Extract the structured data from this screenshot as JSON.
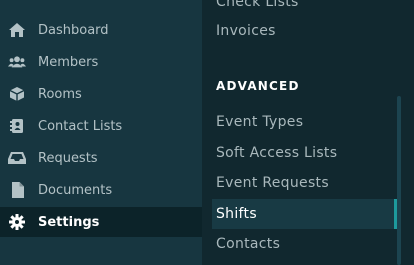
{
  "sidebar": {
    "items": [
      {
        "label": "Dashboard",
        "icon": "home-icon"
      },
      {
        "label": "Members",
        "icon": "users-icon"
      },
      {
        "label": "Rooms",
        "icon": "cube-icon"
      },
      {
        "label": "Contact Lists",
        "icon": "address-book-icon"
      },
      {
        "label": "Requests",
        "icon": "inbox-icon"
      },
      {
        "label": "Documents",
        "icon": "file-icon"
      },
      {
        "label": "Settings",
        "icon": "gear-icon",
        "active": true
      }
    ]
  },
  "submenu": {
    "top_items": [
      {
        "label": "Check Lists"
      },
      {
        "label": "Invoices"
      }
    ],
    "section_heading": "ADVANCED",
    "advanced_items": [
      {
        "label": "Event Types"
      },
      {
        "label": "Soft Access Lists"
      },
      {
        "label": "Event Requests"
      },
      {
        "label": "Shifts",
        "active": true
      },
      {
        "label": "Contacts"
      }
    ]
  },
  "colors": {
    "sidebar_bg": "#173640",
    "main_bg": "#11282f",
    "active_bg": "#0c2329",
    "accent": "#1d9a9d",
    "text_muted": "#b3c2c6"
  }
}
